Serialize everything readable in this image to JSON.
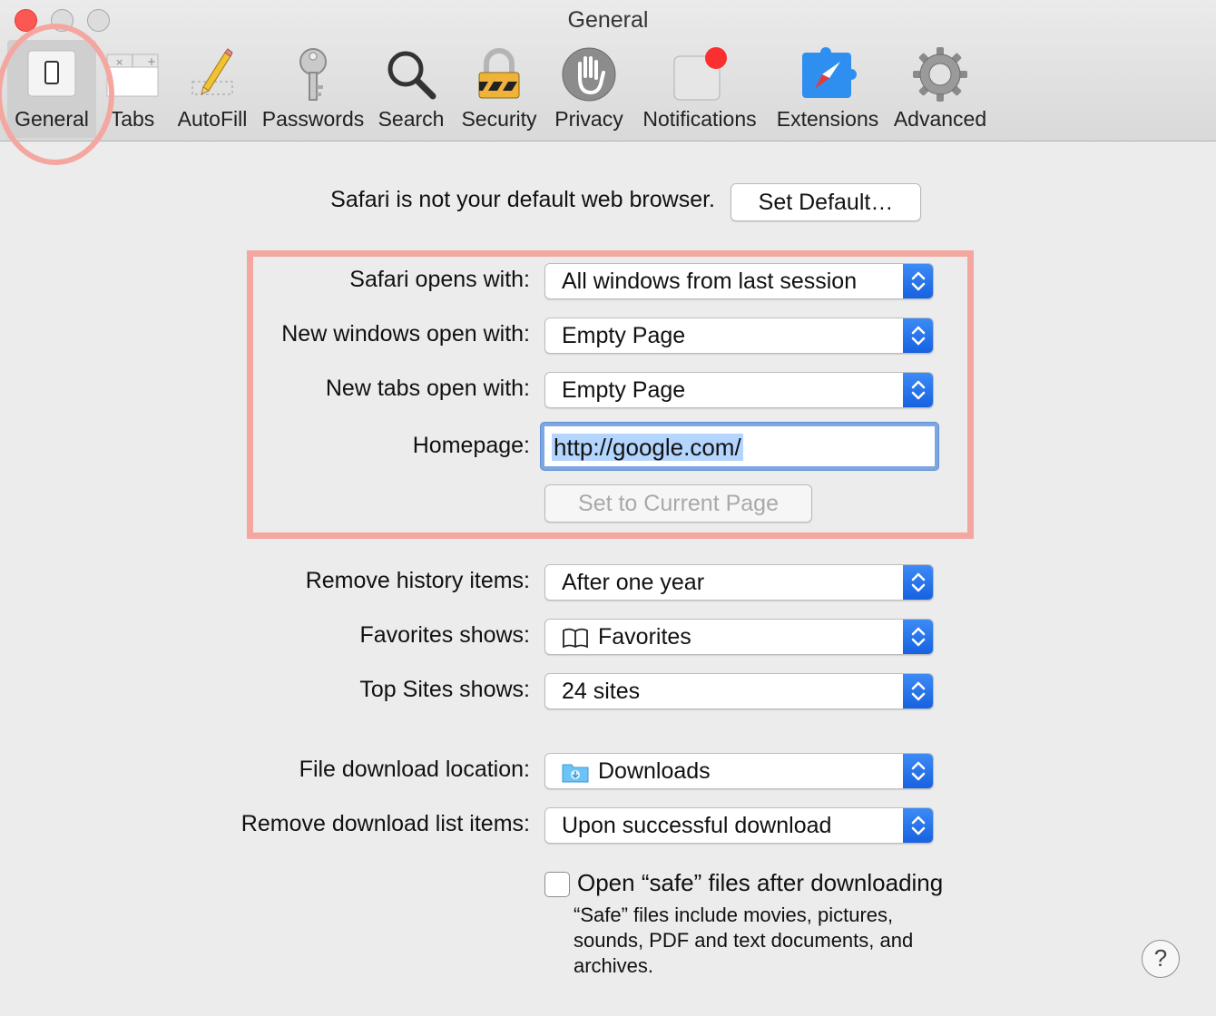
{
  "window": {
    "title": "General"
  },
  "toolbar": {
    "items": [
      {
        "label": "General",
        "icon": "general-switch-icon",
        "selected": true
      },
      {
        "label": "Tabs",
        "icon": "tabs-icon"
      },
      {
        "label": "AutoFill",
        "icon": "pencil-icon"
      },
      {
        "label": "Passwords",
        "icon": "key-icon"
      },
      {
        "label": "Search",
        "icon": "magnifier-icon"
      },
      {
        "label": "Security",
        "icon": "padlock-icon"
      },
      {
        "label": "Privacy",
        "icon": "hand-icon"
      },
      {
        "label": "Notifications",
        "icon": "notification-badge-icon"
      },
      {
        "label": "Extensions",
        "icon": "compass-puzzle-icon"
      },
      {
        "label": "Advanced",
        "icon": "gear-icon"
      }
    ]
  },
  "default_browser": {
    "text": "Safari is not your default web browser.",
    "button": "Set Default…"
  },
  "startup": {
    "safari_opens_label": "Safari opens with:",
    "safari_opens_value": "All windows from last session",
    "new_windows_label": "New windows open with:",
    "new_windows_value": "Empty Page",
    "new_tabs_label": "New tabs open with:",
    "new_tabs_value": "Empty Page",
    "homepage_label": "Homepage:",
    "homepage_value": "http://google.com/",
    "set_current_button": "Set to Current Page"
  },
  "history": {
    "remove_label": "Remove history items:",
    "remove_value": "After one year",
    "favorites_label": "Favorites shows:",
    "favorites_value": "Favorites",
    "topsites_label": "Top Sites shows:",
    "topsites_value": "24 sites"
  },
  "downloads": {
    "location_label": "File download location:",
    "location_value": "Downloads",
    "remove_label": "Remove download list items:",
    "remove_value": "Upon successful download",
    "open_safe_label": "Open “safe” files after downloading",
    "open_safe_checked": false,
    "note_line1": "“Safe” files include movies, pictures,",
    "note_line2": "sounds, PDF and text documents, and",
    "note_line3": "archives."
  },
  "help": {
    "label": "?"
  },
  "colors": {
    "accent": "#1661e0",
    "annotation": "#f4a7a0",
    "close": "#fc5753"
  }
}
